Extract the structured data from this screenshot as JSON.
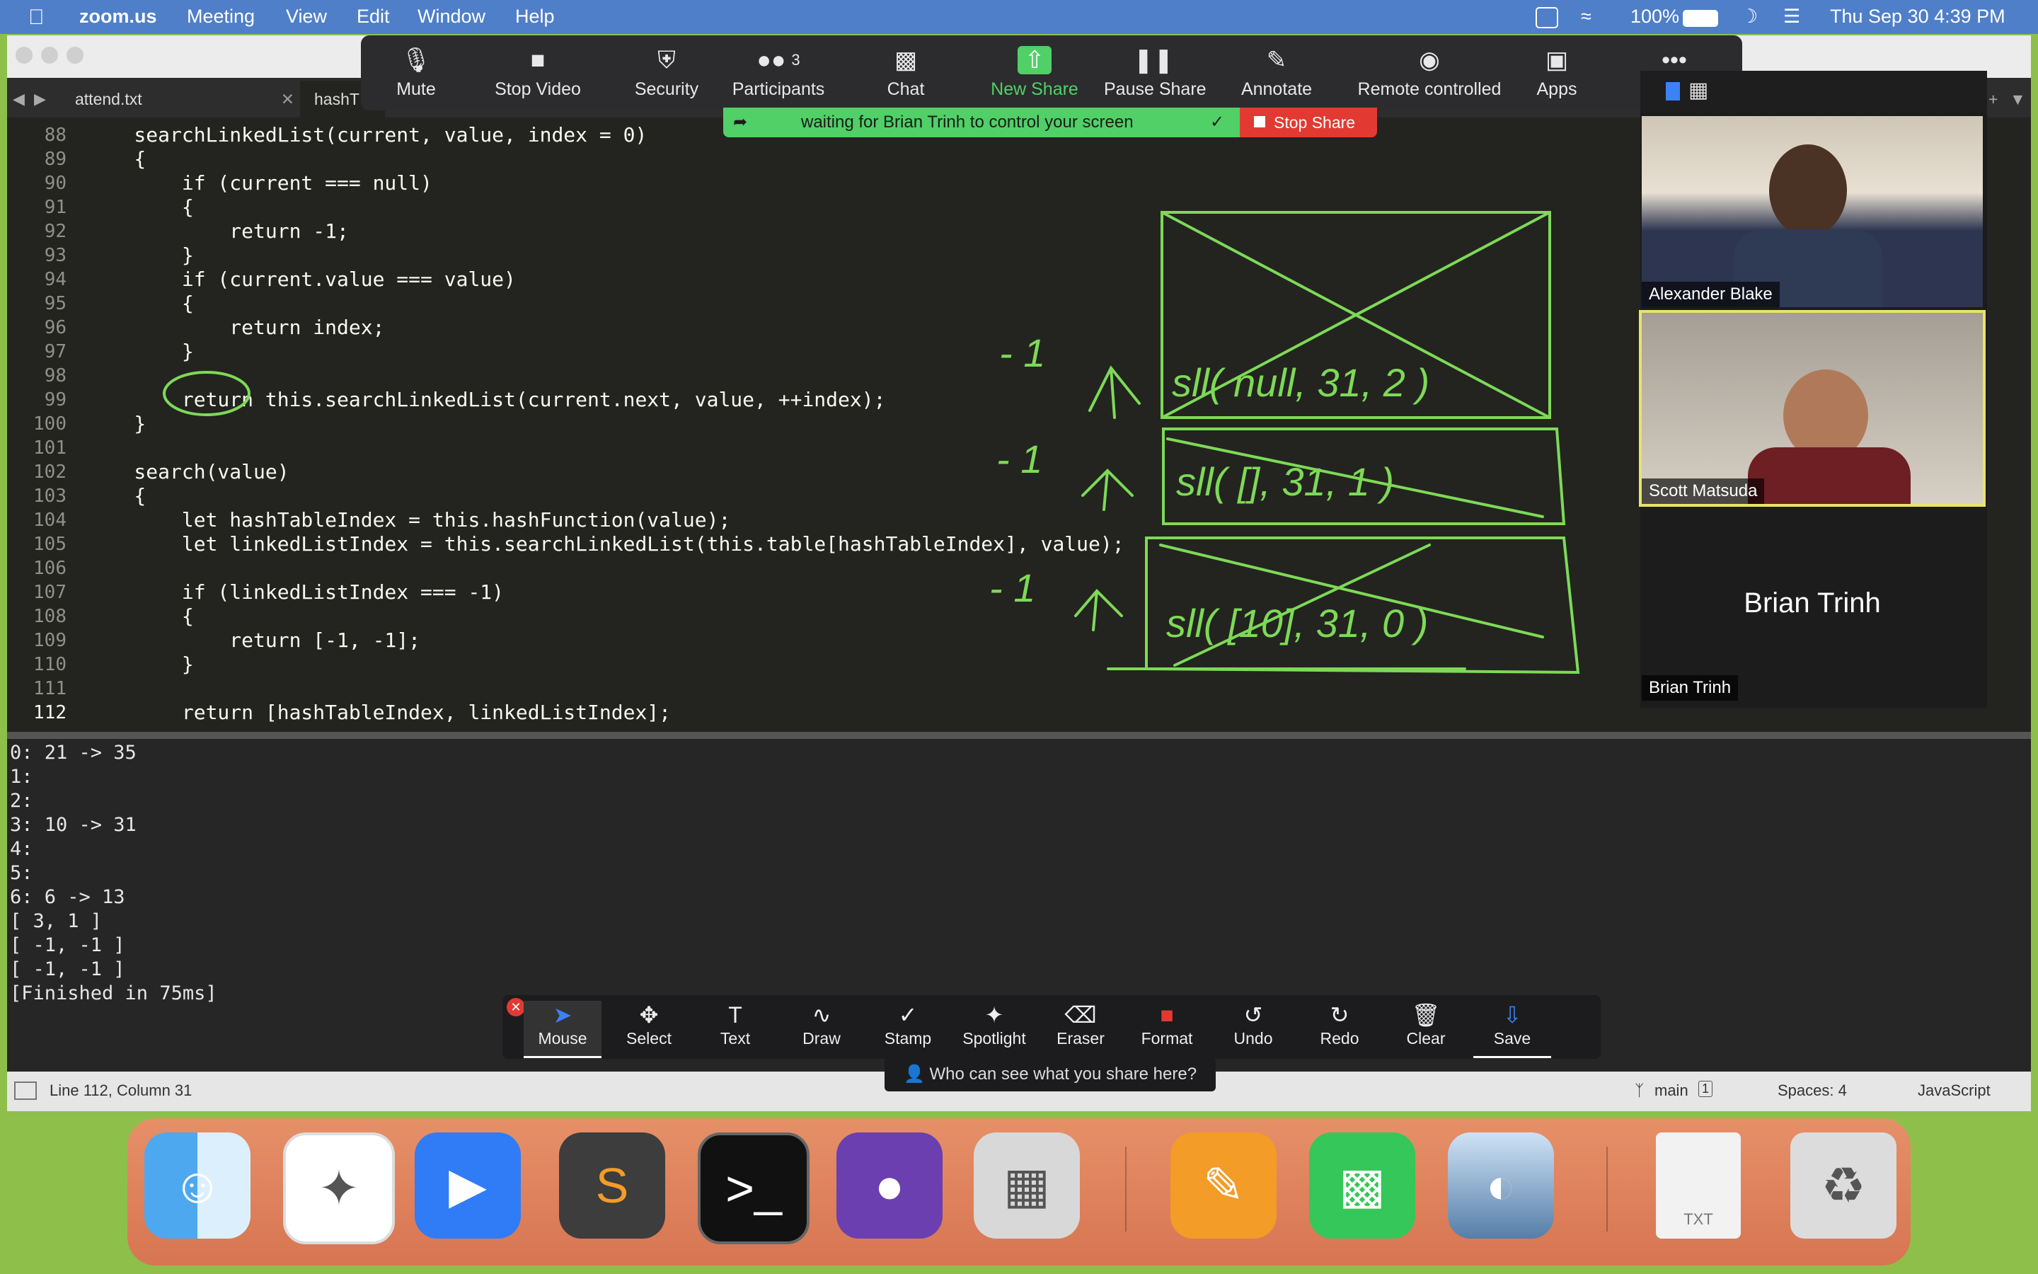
{
  "menubar": {
    "app": "zoom.us",
    "items": [
      "Meeting",
      "View",
      "Edit",
      "Window",
      "Help"
    ],
    "battery": "100%",
    "clock": "Thu Sep 30  4:39 PM"
  },
  "tabs": [
    "attend.txt",
    "hashT"
  ],
  "editor": {
    "lines": [
      {
        "n": "88",
        "t": "    searchLinkedList(current, value, index = 0)"
      },
      {
        "n": "89",
        "t": "    {"
      },
      {
        "n": "90",
        "t": "        if (current === null)"
      },
      {
        "n": "91",
        "t": "        {"
      },
      {
        "n": "92",
        "t": "            return -1;"
      },
      {
        "n": "93",
        "t": "        }"
      },
      {
        "n": "94",
        "t": "        if (current.value === value)"
      },
      {
        "n": "95",
        "t": "        {"
      },
      {
        "n": "96",
        "t": "            return index;"
      },
      {
        "n": "97",
        "t": "        }"
      },
      {
        "n": "98",
        "t": ""
      },
      {
        "n": "99",
        "t": "        return this.searchLinkedList(current.next, value, ++index);"
      },
      {
        "n": "100",
        "t": "    }"
      },
      {
        "n": "101",
        "t": ""
      },
      {
        "n": "102",
        "t": "    search(value)"
      },
      {
        "n": "103",
        "t": "    {"
      },
      {
        "n": "104",
        "t": "        let hashTableIndex = this.hashFunction(value);"
      },
      {
        "n": "105",
        "t": "        let linkedListIndex = this.searchLinkedList(this.table[hashTableIndex], value);"
      },
      {
        "n": "106",
        "t": ""
      },
      {
        "n": "107",
        "t": "        if (linkedListIndex === -1)"
      },
      {
        "n": "108",
        "t": "        {"
      },
      {
        "n": "109",
        "t": "            return [-1, -1];"
      },
      {
        "n": "110",
        "t": "        }"
      },
      {
        "n": "111",
        "t": ""
      },
      {
        "n": "112",
        "t": "        return [hashTableIndex, linkedListIndex];"
      }
    ]
  },
  "output": [
    "0: 21 -> 35",
    "1:",
    "2:",
    "3: 10 -> 31",
    "4:",
    "5:",
    "6: 6 -> 13",
    "[ 3, 1 ]",
    "[ -1, -1 ]",
    "[ -1, -1 ]",
    "[Finished in 75ms]"
  ],
  "statusbar": {
    "position": "Line 112, Column 31",
    "branch": "main",
    "branch_count": "1",
    "spaces": "Spaces: 4",
    "syntax": "JavaScript"
  },
  "zoom": {
    "buttons": [
      {
        "label": "Mute",
        "icon": "microphone-icon"
      },
      {
        "label": "Stop Video",
        "icon": "video-camera-icon"
      },
      {
        "label": "Security",
        "icon": "shield-icon"
      },
      {
        "label": "Participants",
        "icon": "participants-icon",
        "count": "3"
      },
      {
        "label": "Chat",
        "icon": "chat-bubble-icon"
      },
      {
        "label": "New Share",
        "icon": "share-arrow-icon"
      },
      {
        "label": "Pause Share",
        "icon": "pause-icon"
      },
      {
        "label": "Annotate",
        "icon": "pencil-icon"
      },
      {
        "label": "Remote controlled",
        "icon": "mouse-icon"
      },
      {
        "label": "Apps",
        "icon": "apps-icon"
      },
      {
        "label": "More",
        "icon": "more-dots-icon"
      }
    ],
    "banner": "waiting for Brian Trinh to control your screen",
    "stop_share": "Stop Share",
    "accent": "#50d067",
    "stop_color": "#e23a32"
  },
  "participants": [
    {
      "name": "Alexander Blake"
    },
    {
      "name": "Scott Matsuda"
    },
    {
      "name": "Brian Trinh",
      "big": "Brian Trinh"
    }
  ],
  "annotate": {
    "tools": [
      "Mouse",
      "Select",
      "Text",
      "Draw",
      "Stamp",
      "Spotlight",
      "Eraser",
      "Format",
      "Undo",
      "Redo",
      "Clear",
      "Save"
    ],
    "tip": "Who can see what you share here?"
  },
  "whiteboard": {
    "rows": [
      {
        "marker": "- 1",
        "call": "sll( null, 31, 2 )"
      },
      {
        "marker": "- 1",
        "call": "sll( [], 31, 1 )"
      },
      {
        "marker": "- 1",
        "call": "sll( [10], 31, 0 )"
      }
    ],
    "ink_color": "#7ed957"
  },
  "dock": {
    "apps": [
      "finder-icon",
      "safari-icon",
      "zoom-icon",
      "sublime-text-icon",
      "terminal-icon",
      "github-desktop-icon",
      "calculator-icon",
      "pages-icon",
      "messages-icon",
      "preview-icon",
      "txt-file-icon",
      "trash-icon"
    ],
    "txt_label": "TXT"
  }
}
